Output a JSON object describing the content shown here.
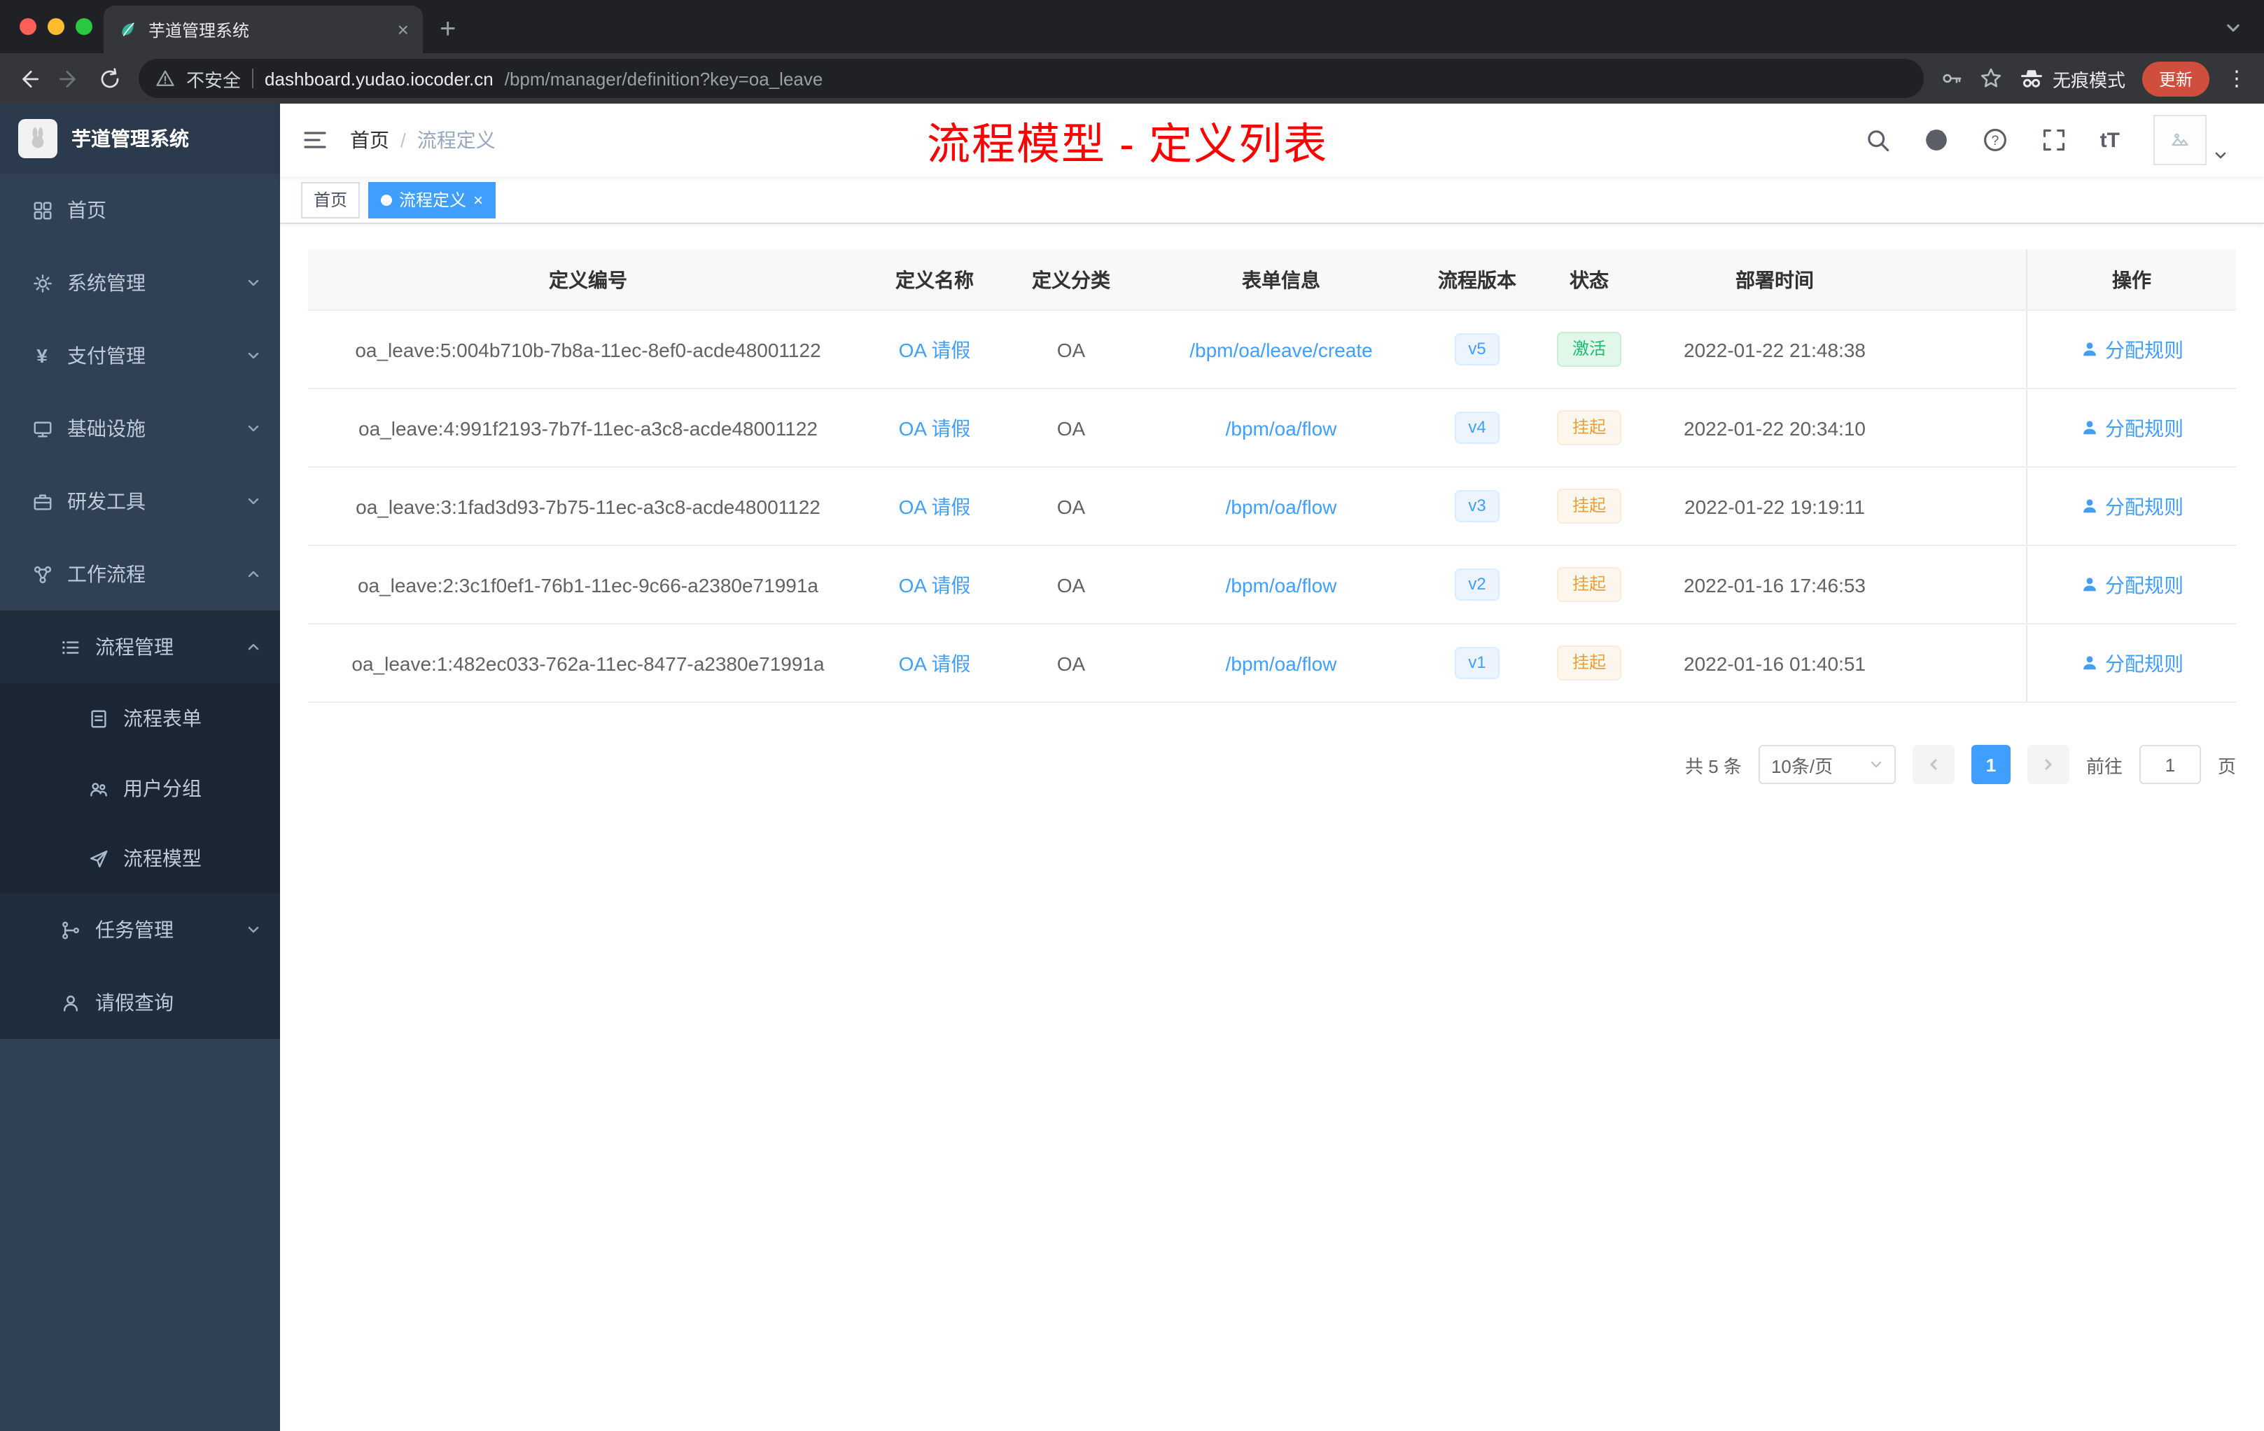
{
  "colors": {
    "primary": "#409eff",
    "success": "#19be6b",
    "warning": "#e6a23c",
    "annotation_red": "#ff0000",
    "sidebar_bg": "#304156",
    "submenu_bg": "#1f2d3d"
  },
  "browser": {
    "tab_title": "芋道管理系统",
    "security_label": "不安全",
    "url_host": "dashboard.yudao.iocoder.cn",
    "url_path": "/bpm/manager/definition?key=oa_leave",
    "incognito_label": "无痕模式",
    "update_label": "更新"
  },
  "sidebar": {
    "app_title": "芋道管理系统",
    "items": [
      {
        "label": "首页",
        "icon": "dashboard-icon"
      },
      {
        "label": "系统管理",
        "icon": "gear-icon"
      },
      {
        "label": "支付管理",
        "icon": "yen-icon"
      },
      {
        "label": "基础设施",
        "icon": "monitor-icon"
      },
      {
        "label": "研发工具",
        "icon": "briefcase-icon"
      },
      {
        "label": "工作流程",
        "icon": "workflow-icon"
      },
      {
        "label": "流程管理",
        "icon": "list-icon"
      },
      {
        "label": "流程表单",
        "icon": "form-icon"
      },
      {
        "label": "用户分组",
        "icon": "users-icon"
      },
      {
        "label": "流程模型",
        "icon": "send-icon"
      },
      {
        "label": "任务管理",
        "icon": "tasks-icon"
      },
      {
        "label": "请假查询",
        "icon": "user-icon"
      }
    ]
  },
  "header": {
    "breadcrumb_home": "首页",
    "breadcrumb_separator": "/",
    "breadcrumb_current": "流程定义",
    "annotation": "流程模型 - 定义列表"
  },
  "tags": {
    "items": [
      {
        "label": "首页",
        "active": false
      },
      {
        "label": "流程定义",
        "active": true
      }
    ]
  },
  "table": {
    "headers": [
      "定义编号",
      "定义名称",
      "定义分类",
      "表单信息",
      "流程版本",
      "状态",
      "部署时间",
      "操作"
    ],
    "rows": [
      {
        "id": "oa_leave:5:004b710b-7b8a-11ec-8ef0-acde48001122",
        "name": "OA 请假",
        "category": "OA",
        "form": "/bpm/oa/leave/create",
        "version": "v5",
        "status": "激活",
        "status_type": "active",
        "deploy_time": "2022-01-22 21:48:38",
        "action": "分配规则"
      },
      {
        "id": "oa_leave:4:991f2193-7b7f-11ec-a3c8-acde48001122",
        "name": "OA 请假",
        "category": "OA",
        "form": "/bpm/oa/flow",
        "version": "v4",
        "status": "挂起",
        "status_type": "suspended",
        "deploy_time": "2022-01-22 20:34:10",
        "action": "分配规则"
      },
      {
        "id": "oa_leave:3:1fad3d93-7b75-11ec-a3c8-acde48001122",
        "name": "OA 请假",
        "category": "OA",
        "form": "/bpm/oa/flow",
        "version": "v3",
        "status": "挂起",
        "status_type": "suspended",
        "deploy_time": "2022-01-22 19:19:11",
        "action": "分配规则"
      },
      {
        "id": "oa_leave:2:3c1f0ef1-76b1-11ec-9c66-a2380e71991a",
        "name": "OA 请假",
        "category": "OA",
        "form": "/bpm/oa/flow",
        "version": "v2",
        "status": "挂起",
        "status_type": "suspended",
        "deploy_time": "2022-01-16 17:46:53",
        "action": "分配规则"
      },
      {
        "id": "oa_leave:1:482ec033-762a-11ec-8477-a2380e71991a",
        "name": "OA 请假",
        "category": "OA",
        "form": "/bpm/oa/flow",
        "version": "v1",
        "status": "挂起",
        "status_type": "suspended",
        "deploy_time": "2022-01-16 01:40:51",
        "action": "分配规则"
      }
    ]
  },
  "pagination": {
    "total_label": "共 5 条",
    "page_size_label": "10条/页",
    "current_page": "1",
    "goto_label": "前往",
    "goto_value": "1",
    "page_unit": "页"
  }
}
